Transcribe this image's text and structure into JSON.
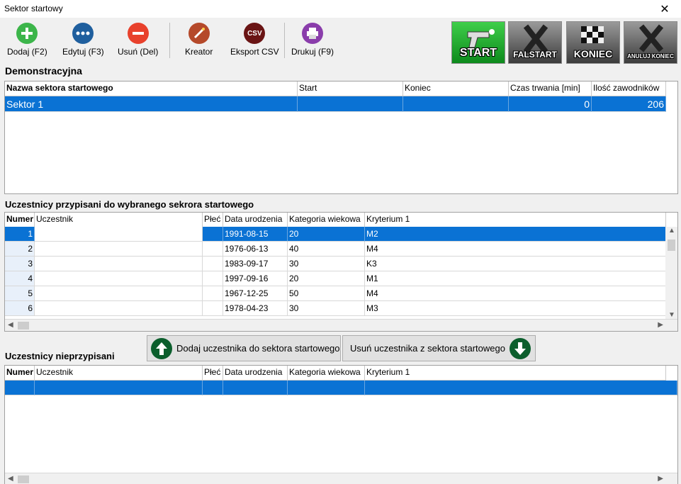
{
  "window": {
    "title": "Sektor startowy"
  },
  "toolbar": {
    "add": "Dodaj (F2)",
    "edit": "Edytuj (F3)",
    "delete": "Usuń (Del)",
    "wizard": "Kreator",
    "export": "Eksport CSV",
    "export_icon_text": "CSV",
    "print": "Drukuj (F9)",
    "start": "START",
    "falstart": "FALSTART",
    "finish": "KONIEC",
    "cancel_finish": "ANULUJ KONIEC"
  },
  "event": {
    "name": "Demonstracyjna"
  },
  "sectors": {
    "columns": [
      "Nazwa sektora startowego",
      "Start",
      "Koniec",
      "Czas trwania [min]",
      "Ilość zawodników"
    ],
    "rows": [
      {
        "name": "Sektor 1",
        "start": "",
        "end": "",
        "duration": "0",
        "count": "206"
      }
    ]
  },
  "assigned": {
    "heading": "Uczestnicy przypisani do wybranego sekrora startowego",
    "columns": [
      "Numer",
      "Uczestnik",
      "Płeć",
      "Data urodzenia",
      "Kategoria wiekowa",
      "Kryterium 1"
    ],
    "rows": [
      {
        "num": "1",
        "name": "",
        "sex": "",
        "dob": "1991-08-15",
        "cat": "20",
        "crit": "M2"
      },
      {
        "num": "2",
        "name": "",
        "sex": "",
        "dob": "1976-06-13",
        "cat": "40",
        "crit": "M4"
      },
      {
        "num": "3",
        "name": "",
        "sex": "",
        "dob": "1983-09-17",
        "cat": "30",
        "crit": "K3"
      },
      {
        "num": "4",
        "name": "",
        "sex": "",
        "dob": "1997-09-16",
        "cat": "20",
        "crit": "M1"
      },
      {
        "num": "5",
        "name": "",
        "sex": "",
        "dob": "1967-12-25",
        "cat": "50",
        "crit": "M4"
      },
      {
        "num": "6",
        "name": "",
        "sex": "",
        "dob": "1978-04-23",
        "cat": "30",
        "crit": "M3"
      }
    ]
  },
  "actions": {
    "add_to_sector": "Dodaj uczestnika do sektora startowego",
    "remove_from_sector": "Usuń uczestnika z sektora startowego"
  },
  "unassigned": {
    "heading": "Uczestnicy nieprzypisani",
    "columns": [
      "Numer",
      "Uczestnik",
      "Płeć",
      "Data urodzenia",
      "Kategoria wiekowa",
      "Kryterium 1"
    ]
  },
  "colors": {
    "selection": "#0a72d4",
    "green": "#0b5e2c",
    "add": "#3cb54a",
    "edit": "#1f5f9e",
    "delete": "#e8412c"
  }
}
